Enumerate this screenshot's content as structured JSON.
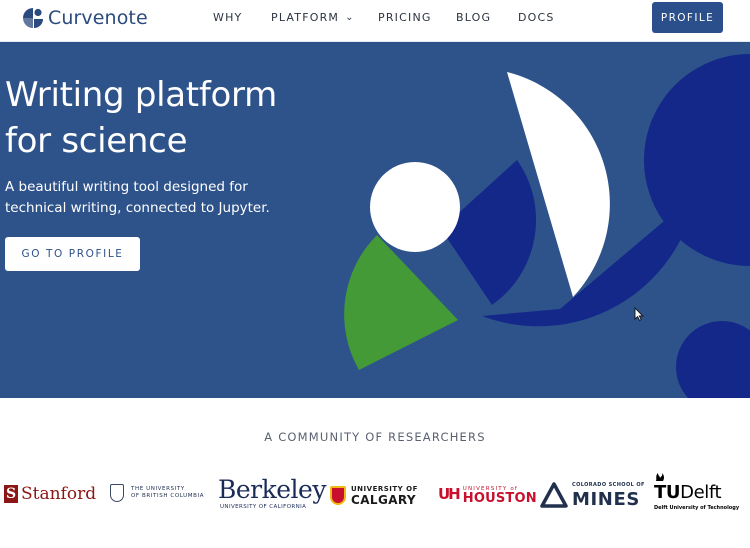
{
  "nav": {
    "logo_text": "Curvenote",
    "items": [
      {
        "label": "WHY"
      },
      {
        "label": "PLATFORM"
      },
      {
        "label": "PRICING"
      },
      {
        "label": "BLOG"
      },
      {
        "label": "DOCS"
      }
    ],
    "profile_button": "PROFILE"
  },
  "hero": {
    "title_line1": "Writing platform",
    "title_line2": "for science",
    "subtitle_line1": "A beautiful writing tool designed for",
    "subtitle_line2": "technical writing, connected to Jupyter.",
    "cta_label": "GO TO PROFILE"
  },
  "community": {
    "title": "A COMMUNITY OF RESEARCHERS",
    "universities": [
      {
        "name": "Stanford",
        "mark": "S"
      },
      {
        "line1": "THE UNIVERSITY",
        "line2": "OF BRITISH COLUMBIA"
      },
      {
        "name": "Berkeley",
        "sub": "UNIVERSITY OF CALIFORNIA"
      },
      {
        "line1": "UNIVERSITY OF",
        "line2": "CALGARY"
      },
      {
        "mark": "UH",
        "line1": "UNIVERSITY of",
        "line2": "HOUSTON"
      },
      {
        "line1": "COLORADO SCHOOL OF",
        "line2": "MINES"
      },
      {
        "name_prefix": "TU",
        "name": "Delft",
        "sub": "Delft University of Technology"
      }
    ]
  },
  "colors": {
    "brand": "#2b4f8a",
    "hero_bg": "#2e528a",
    "navy_shape": "#14288a",
    "green_shape": "#439a37"
  },
  "icons": {
    "logo": "curvenote-logo-icon",
    "platform_dropdown": "chevron-down-icon",
    "cursor": "mouse-pointer-icon"
  }
}
